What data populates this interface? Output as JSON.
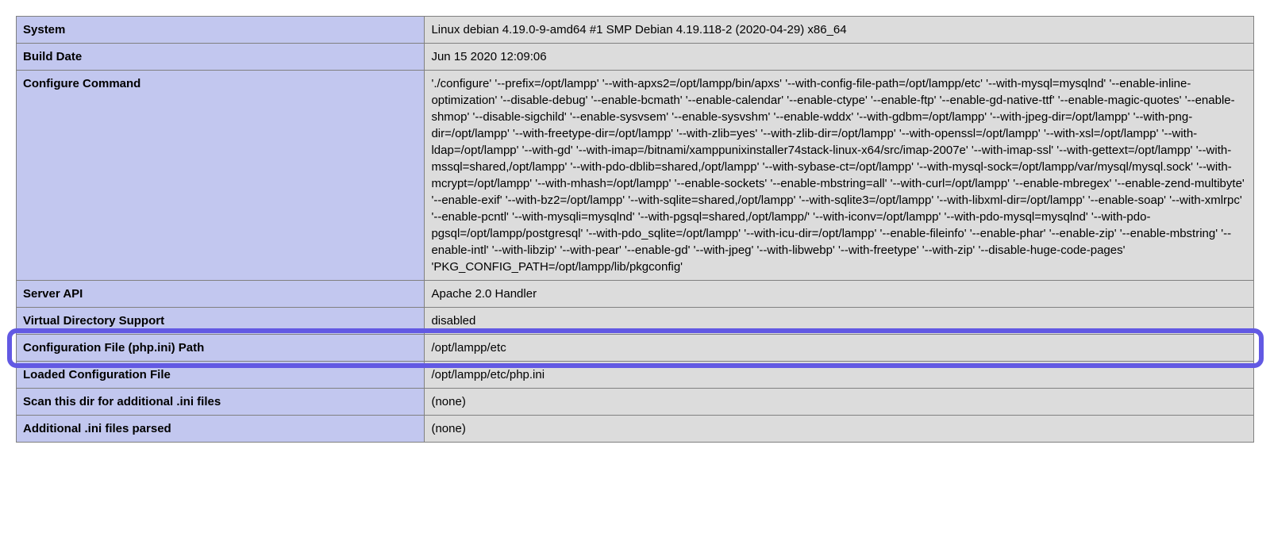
{
  "rows": [
    {
      "key": "System",
      "value": "Linux debian 4.19.0-9-amd64 #1 SMP Debian 4.19.118-2 (2020-04-29) x86_64",
      "name": "row-system"
    },
    {
      "key": "Build Date",
      "value": "Jun 15 2020 12:09:06",
      "name": "row-build-date"
    },
    {
      "key": "Configure Command",
      "value": "'./configure' '--prefix=/opt/lampp' '--with-apxs2=/opt/lampp/bin/apxs' '--with-config-file-path=/opt/lampp/etc' '--with-mysql=mysqlnd' '--enable-inline-optimization' '--disable-debug' '--enable-bcmath' '--enable-calendar' '--enable-ctype' '--enable-ftp' '--enable-gd-native-ttf' '--enable-magic-quotes' '--enable-shmop' '--disable-sigchild' '--enable-sysvsem' '--enable-sysvshm' '--enable-wddx' '--with-gdbm=/opt/lampp' '--with-jpeg-dir=/opt/lampp' '--with-png-dir=/opt/lampp' '--with-freetype-dir=/opt/lampp' '--with-zlib=yes' '--with-zlib-dir=/opt/lampp' '--with-openssl=/opt/lampp' '--with-xsl=/opt/lampp' '--with-ldap=/opt/lampp' '--with-gd' '--with-imap=/bitnami/xamppunixinstaller74stack-linux-x64/src/imap-2007e' '--with-imap-ssl' '--with-gettext=/opt/lampp' '--with-mssql=shared,/opt/lampp' '--with-pdo-dblib=shared,/opt/lampp' '--with-sybase-ct=/opt/lampp' '--with-mysql-sock=/opt/lampp/var/mysql/mysql.sock' '--with-mcrypt=/opt/lampp' '--with-mhash=/opt/lampp' '--enable-sockets' '--enable-mbstring=all' '--with-curl=/opt/lampp' '--enable-mbregex' '--enable-zend-multibyte' '--enable-exif' '--with-bz2=/opt/lampp' '--with-sqlite=shared,/opt/lampp' '--with-sqlite3=/opt/lampp' '--with-libxml-dir=/opt/lampp' '--enable-soap' '--with-xmlrpc' '--enable-pcntl' '--with-mysqli=mysqlnd' '--with-pgsql=shared,/opt/lampp/' '--with-iconv=/opt/lampp' '--with-pdo-mysql=mysqlnd' '--with-pdo-pgsql=/opt/lampp/postgresql' '--with-pdo_sqlite=/opt/lampp' '--with-icu-dir=/opt/lampp' '--enable-fileinfo' '--enable-phar' '--enable-zip' '--enable-mbstring' '--enable-intl' '--with-libzip' '--with-pear' '--enable-gd' '--with-jpeg' '--with-libwebp' '--with-freetype' '--with-zip' '--disable-huge-code-pages' 'PKG_CONFIG_PATH=/opt/lampp/lib/pkgconfig'",
      "name": "row-configure-command"
    },
    {
      "key": "Server API",
      "value": "Apache 2.0 Handler",
      "name": "row-server-api"
    },
    {
      "key": "Virtual Directory Support",
      "value": "disabled",
      "name": "row-virtual-directory-support"
    },
    {
      "key": "Configuration File (php.ini) Path",
      "value": "/opt/lampp/etc",
      "name": "row-config-file-path",
      "highlighted": true
    },
    {
      "key": "Loaded Configuration File",
      "value": "/opt/lampp/etc/php.ini",
      "name": "row-loaded-config-file"
    },
    {
      "key": "Scan this dir for additional .ini files",
      "value": "(none)",
      "name": "row-scan-dir"
    },
    {
      "key": "Additional .ini files parsed",
      "value": "(none)",
      "name": "row-additional-ini"
    }
  ]
}
